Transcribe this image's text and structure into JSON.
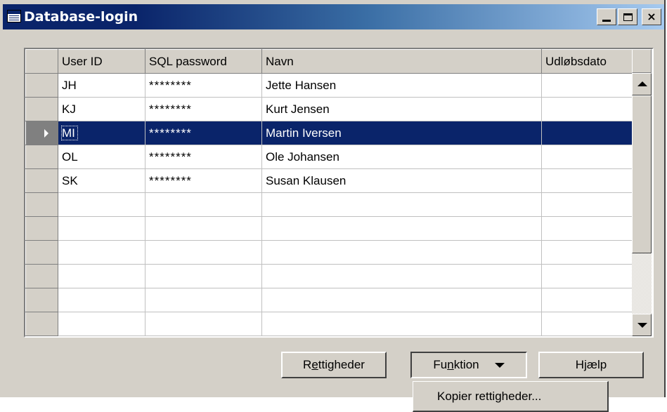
{
  "window": {
    "title": "Database-login",
    "icon": "table-icon"
  },
  "title_buttons": {
    "minimize": "minimize-icon",
    "maximize": "maximize-icon",
    "close": "×"
  },
  "table": {
    "columns": [
      "User ID",
      "SQL password",
      "Navn",
      "Udløbsdato"
    ],
    "rows": [
      {
        "user_id": "JH",
        "password": "********",
        "name": "Jette Hansen",
        "expiry": ""
      },
      {
        "user_id": "KJ",
        "password": "********",
        "name": "Kurt Jensen",
        "expiry": ""
      },
      {
        "user_id": "MI",
        "password": "********",
        "name": "Martin Iversen",
        "expiry": ""
      },
      {
        "user_id": "OL",
        "password": "********",
        "name": "Ole Johansen",
        "expiry": ""
      },
      {
        "user_id": "SK",
        "password": "********",
        "name": "Susan Klausen",
        "expiry": ""
      }
    ],
    "selected_row": 2,
    "selection_color": "#0a246a"
  },
  "buttons": {
    "rights": {
      "pre": "R",
      "u": "e",
      "post": "ttigheder"
    },
    "function": {
      "pre": "Fu",
      "u": "n",
      "post": "ktion"
    },
    "help": {
      "label": "Hjælp"
    }
  },
  "menu": {
    "items": [
      "Kopier rettigheder..."
    ]
  }
}
